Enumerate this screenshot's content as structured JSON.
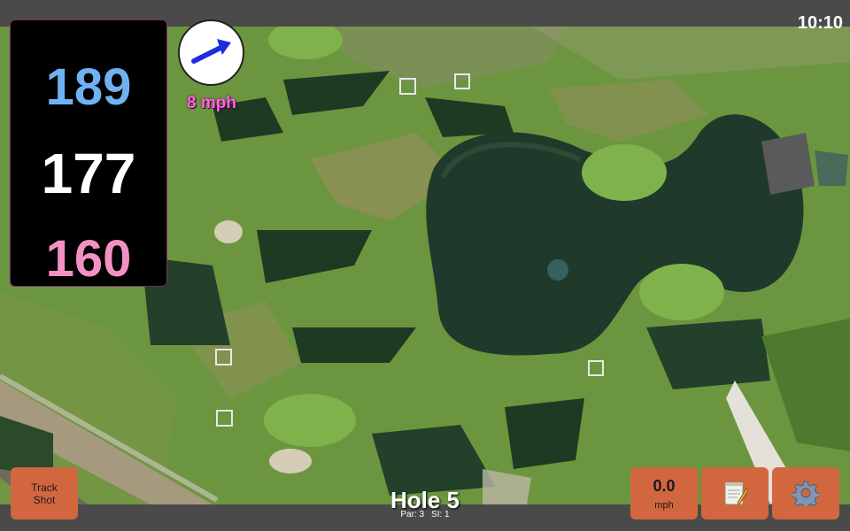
{
  "status_bar": {
    "time": "10:10"
  },
  "distances": {
    "back": "189",
    "middle": "177",
    "front": "160"
  },
  "colors": {
    "back": "#6fb2f2",
    "middle": "#ffffff",
    "front": "#f391c4",
    "wind_speed": "#ff66dd",
    "button": "#d2673f",
    "wind_arrow": "#1a2ee0"
  },
  "wind": {
    "speed_label": "8 mph",
    "direction_icon": "wind-arrow-icon"
  },
  "hole": {
    "title": "Hole 5",
    "par": "Par: 3",
    "si": "SI: 1"
  },
  "buttons": {
    "track_shot_line1": "Track",
    "track_shot_line2": "Shot",
    "speed_value": "0.0",
    "speed_unit": "mph",
    "notes_icon": "notepad-icon",
    "settings_icon": "gear-icon"
  },
  "map": {
    "type": "satellite-aerial-golf-course"
  }
}
